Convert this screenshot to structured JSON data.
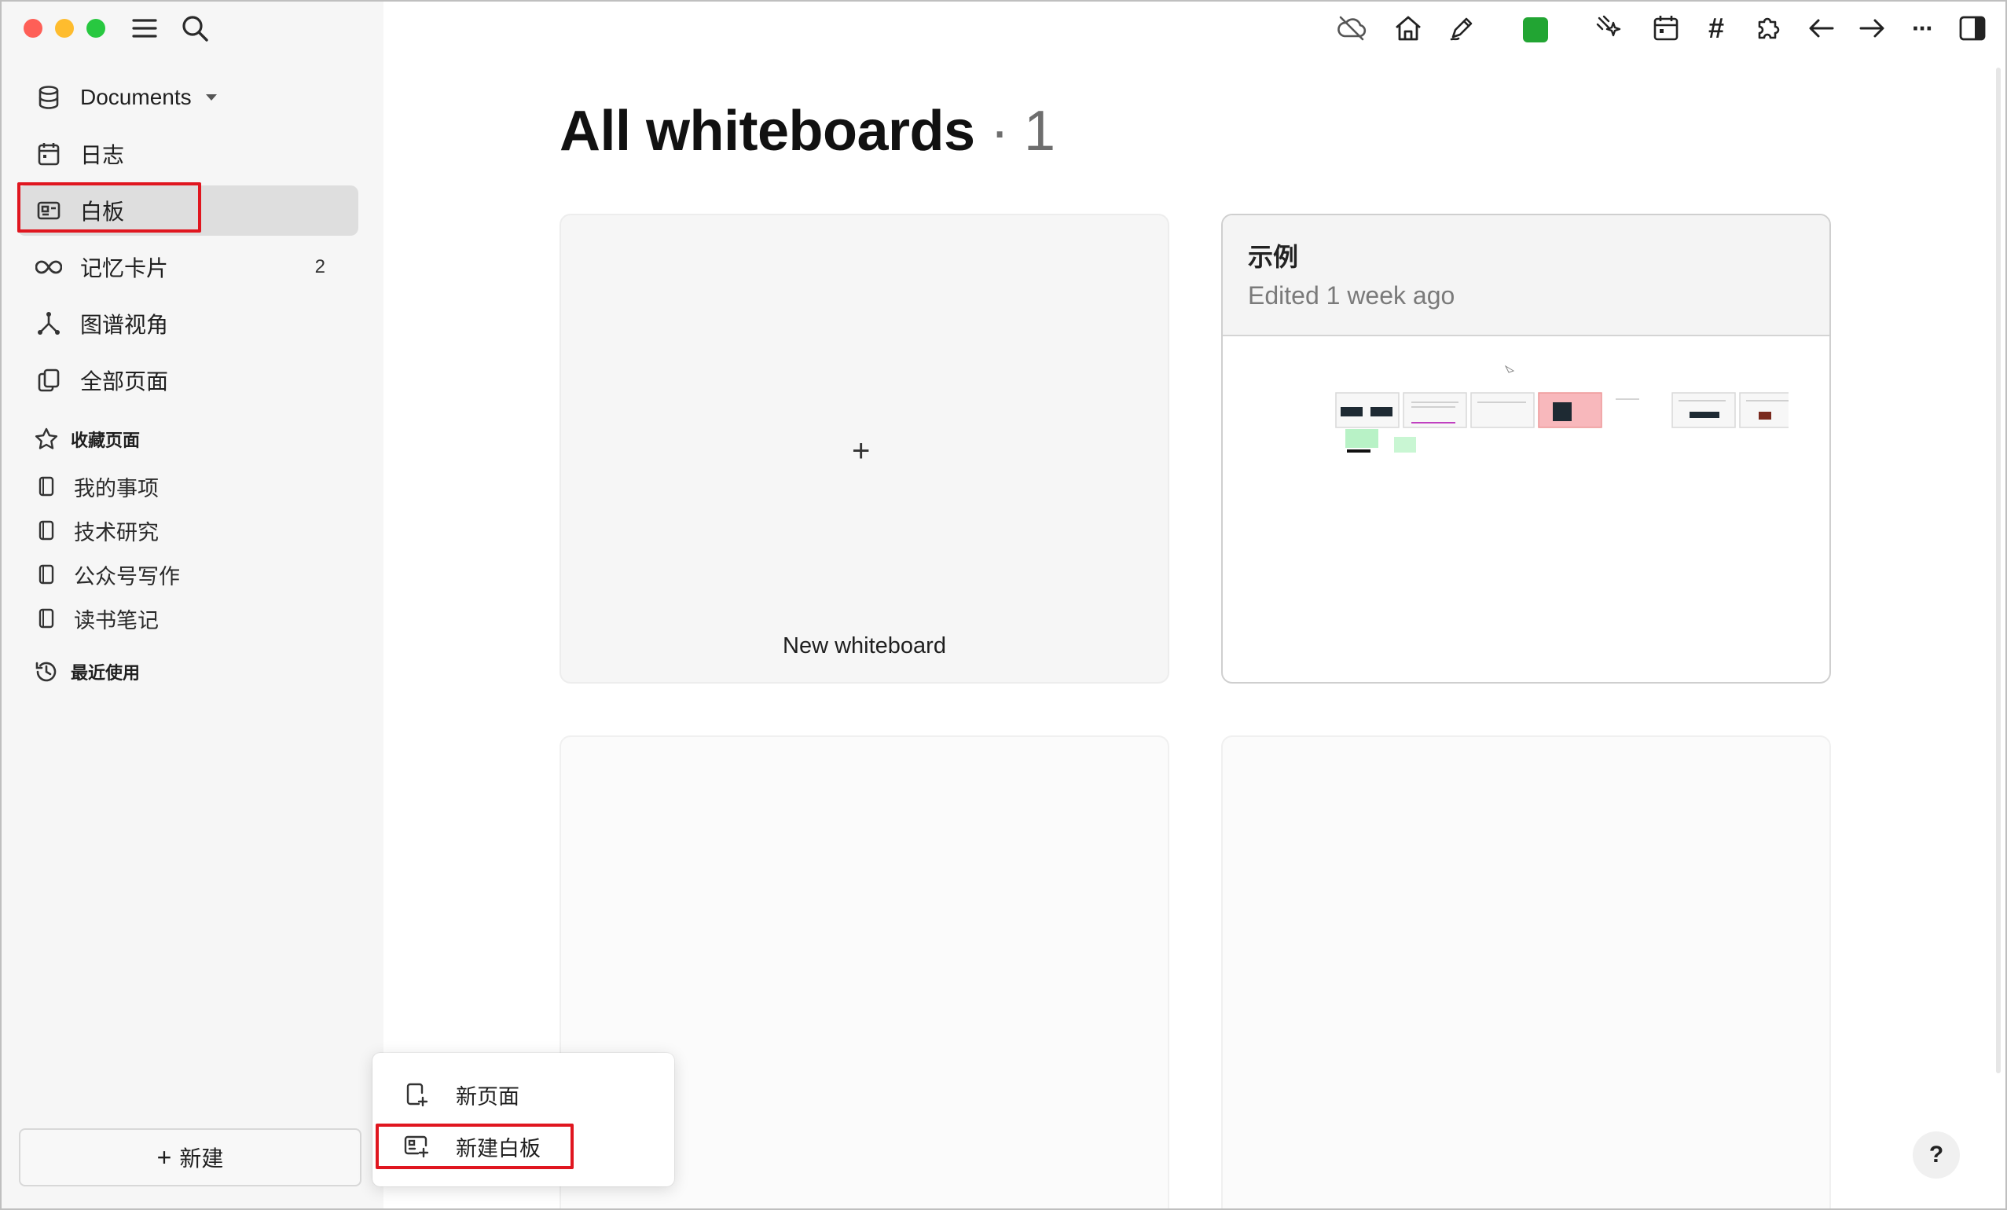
{
  "sidebar": {
    "workspace": {
      "label": "Documents"
    },
    "items": [
      {
        "label": "日志"
      },
      {
        "label": "白板"
      },
      {
        "label": "记忆卡片",
        "badge": "2"
      },
      {
        "label": "图谱视角"
      },
      {
        "label": "全部页面"
      }
    ],
    "favorites": {
      "title": "收藏页面",
      "items": [
        "我的事项",
        "技术研究",
        "公众号写作",
        "读书笔记"
      ]
    },
    "recent": {
      "title": "最近使用"
    },
    "new_button": {
      "plus": "+",
      "label": "新建"
    }
  },
  "new_menu": {
    "items": [
      {
        "label": "新页面"
      },
      {
        "label": "新建白板"
      }
    ]
  },
  "toolbar": {
    "accent_color": "#22a533",
    "icons": [
      "cloud-off-icon",
      "home-icon",
      "pen-icon",
      "color-swatch",
      "sparkles-icon",
      "calendar-icon",
      "hashtag-icon",
      "puzzle-icon",
      "arrow-left-icon",
      "arrow-right-icon",
      "more-icon",
      "sidebar-right-icon"
    ],
    "hashtag": "#",
    "more": "···"
  },
  "main": {
    "title": "All whiteboards",
    "separator": " · ",
    "count": "1",
    "new_card": {
      "plus": "+",
      "label": "New whiteboard"
    },
    "boards": [
      {
        "title": "示例",
        "edited": "Edited 1 week ago"
      }
    ]
  },
  "help": {
    "label": "?"
  },
  "highlight_color": "#e0161f"
}
